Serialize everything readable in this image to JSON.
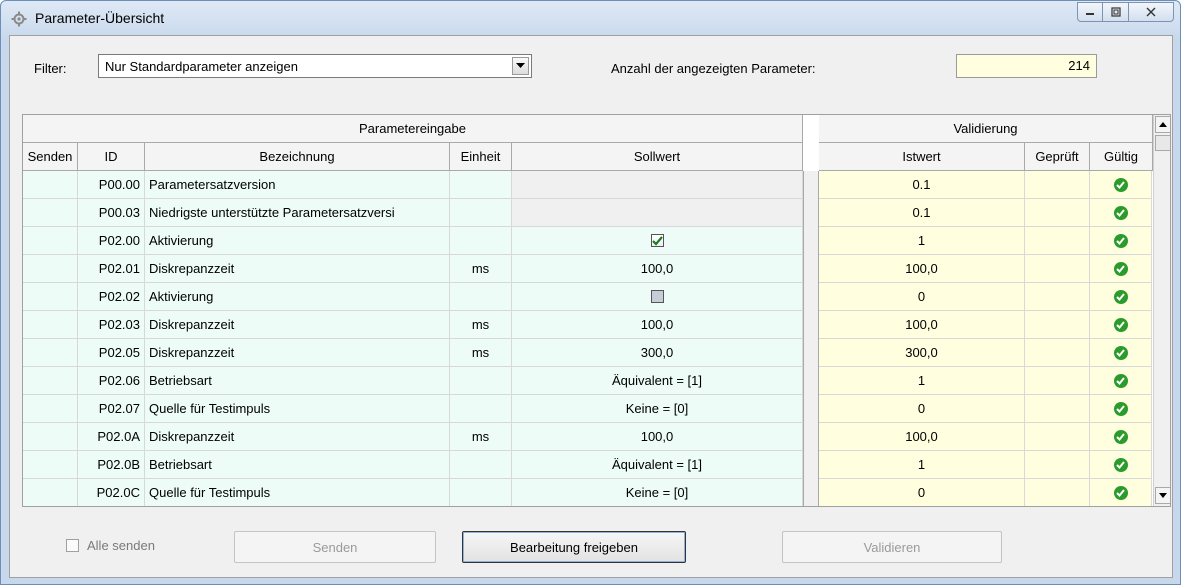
{
  "window": {
    "title": "Parameter-Übersicht"
  },
  "filter": {
    "label": "Filter:",
    "selected": "Nur Standardparameter anzeigen"
  },
  "count": {
    "label": "Anzahl der angezeigten Parameter:",
    "value": "214"
  },
  "grid": {
    "group_input": "Parametereingabe",
    "group_validation": "Validierung",
    "columns": {
      "send": "Senden",
      "id": "ID",
      "name": "Bezeichnung",
      "unit": "Einheit",
      "setpoint": "Sollwert",
      "actual": "Istwert",
      "checked": "Geprüft",
      "valid": "Gültig"
    },
    "rows": [
      {
        "id": "P00.00",
        "name": "Parametersatzversion",
        "unit": "",
        "soll": "",
        "soll_type": "readonly",
        "ist": "0.1"
      },
      {
        "id": "P00.03",
        "name": "Niedrigste unterstützte Parametersatzversi",
        "unit": "",
        "soll": "",
        "soll_type": "readonly",
        "ist": "0.1"
      },
      {
        "id": "P02.00",
        "name": "Aktivierung",
        "unit": "",
        "soll": "",
        "soll_type": "check_on",
        "ist": "1"
      },
      {
        "id": "P02.01",
        "name": "Diskrepanzzeit",
        "unit": "ms",
        "soll": "100,0",
        "soll_type": "text",
        "ist": "100,0"
      },
      {
        "id": "P02.02",
        "name": "Aktivierung",
        "unit": "",
        "soll": "",
        "soll_type": "check_off",
        "ist": "0"
      },
      {
        "id": "P02.03",
        "name": "Diskrepanzzeit",
        "unit": "ms",
        "soll": "100,0",
        "soll_type": "text",
        "ist": "100,0"
      },
      {
        "id": "P02.05",
        "name": "Diskrepanzzeit",
        "unit": "ms",
        "soll": "300,0",
        "soll_type": "text",
        "ist": "300,0"
      },
      {
        "id": "P02.06",
        "name": "Betriebsart",
        "unit": "",
        "soll": "Äquivalent = [1]",
        "soll_type": "text",
        "ist": "1"
      },
      {
        "id": "P02.07",
        "name": "Quelle für Testimpuls",
        "unit": "",
        "soll": "Keine = [0]",
        "soll_type": "text",
        "ist": "0"
      },
      {
        "id": "P02.0A",
        "name": "Diskrepanzzeit",
        "unit": "ms",
        "soll": "100,0",
        "soll_type": "text",
        "ist": "100,0"
      },
      {
        "id": "P02.0B",
        "name": "Betriebsart",
        "unit": "",
        "soll": "Äquivalent = [1]",
        "soll_type": "text",
        "ist": "1"
      },
      {
        "id": "P02.0C",
        "name": "Quelle für Testimpuls",
        "unit": "",
        "soll": "Keine = [0]",
        "soll_type": "text",
        "ist": "0"
      }
    ]
  },
  "footer": {
    "send_all_label": "Alle senden",
    "send_button": "Senden",
    "enable_edit_button": "Bearbeitung freigeben",
    "validate_button": "Validieren"
  },
  "colors": {
    "input_cell_bg": "#edfcf7",
    "validation_cell_bg": "#ffffe0",
    "valid_ok": "#2b9c2b"
  },
  "icons": {
    "valid": "check-circle-icon",
    "app": "gear-icon"
  }
}
